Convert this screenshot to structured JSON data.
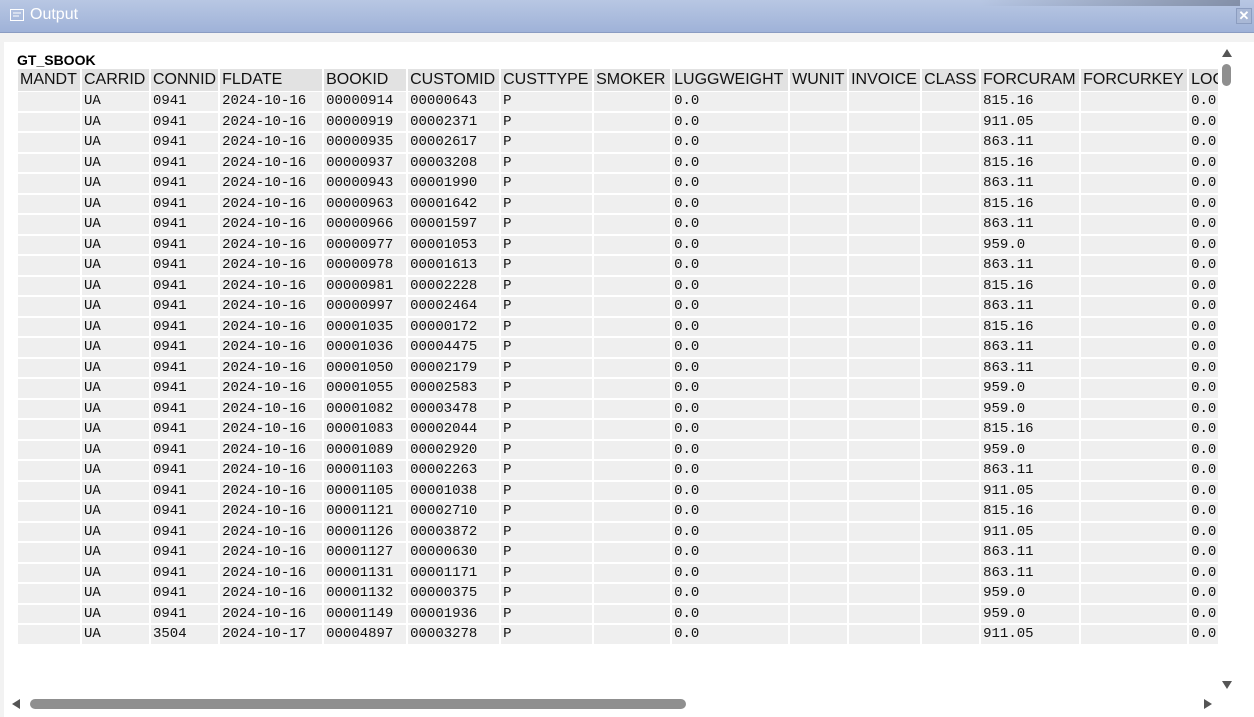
{
  "window": {
    "title": "Output",
    "close_glyph": "✕"
  },
  "table": {
    "title": "GT_SBOOK",
    "columns": [
      "MANDT",
      "CARRID",
      "CONNID",
      "FLDATE",
      "BOOKID",
      "CUSTOMID",
      "CUSTTYPE",
      "SMOKER",
      "LUGGWEIGHT",
      "WUNIT",
      "INVOICE",
      "CLASS",
      "FORCURAM",
      "FORCURKEY",
      "LOCCU"
    ],
    "rows": [
      [
        "",
        "UA",
        "0941",
        "2024-10-16",
        "00000914",
        "00000643",
        "P",
        "",
        "0.0",
        "",
        "",
        "",
        "815.16",
        "",
        "0.0"
      ],
      [
        "",
        "UA",
        "0941",
        "2024-10-16",
        "00000919",
        "00002371",
        "P",
        "",
        "0.0",
        "",
        "",
        "",
        "911.05",
        "",
        "0.0"
      ],
      [
        "",
        "UA",
        "0941",
        "2024-10-16",
        "00000935",
        "00002617",
        "P",
        "",
        "0.0",
        "",
        "",
        "",
        "863.11",
        "",
        "0.0"
      ],
      [
        "",
        "UA",
        "0941",
        "2024-10-16",
        "00000937",
        "00003208",
        "P",
        "",
        "0.0",
        "",
        "",
        "",
        "815.16",
        "",
        "0.0"
      ],
      [
        "",
        "UA",
        "0941",
        "2024-10-16",
        "00000943",
        "00001990",
        "P",
        "",
        "0.0",
        "",
        "",
        "",
        "863.11",
        "",
        "0.0"
      ],
      [
        "",
        "UA",
        "0941",
        "2024-10-16",
        "00000963",
        "00001642",
        "P",
        "",
        "0.0",
        "",
        "",
        "",
        "815.16",
        "",
        "0.0"
      ],
      [
        "",
        "UA",
        "0941",
        "2024-10-16",
        "00000966",
        "00001597",
        "P",
        "",
        "0.0",
        "",
        "",
        "",
        "863.11",
        "",
        "0.0"
      ],
      [
        "",
        "UA",
        "0941",
        "2024-10-16",
        "00000977",
        "00001053",
        "P",
        "",
        "0.0",
        "",
        "",
        "",
        "959.0",
        "",
        "0.0"
      ],
      [
        "",
        "UA",
        "0941",
        "2024-10-16",
        "00000978",
        "00001613",
        "P",
        "",
        "0.0",
        "",
        "",
        "",
        "863.11",
        "",
        "0.0"
      ],
      [
        "",
        "UA",
        "0941",
        "2024-10-16",
        "00000981",
        "00002228",
        "P",
        "",
        "0.0",
        "",
        "",
        "",
        "815.16",
        "",
        "0.0"
      ],
      [
        "",
        "UA",
        "0941",
        "2024-10-16",
        "00000997",
        "00002464",
        "P",
        "",
        "0.0",
        "",
        "",
        "",
        "863.11",
        "",
        "0.0"
      ],
      [
        "",
        "UA",
        "0941",
        "2024-10-16",
        "00001035",
        "00000172",
        "P",
        "",
        "0.0",
        "",
        "",
        "",
        "815.16",
        "",
        "0.0"
      ],
      [
        "",
        "UA",
        "0941",
        "2024-10-16",
        "00001036",
        "00004475",
        "P",
        "",
        "0.0",
        "",
        "",
        "",
        "863.11",
        "",
        "0.0"
      ],
      [
        "",
        "UA",
        "0941",
        "2024-10-16",
        "00001050",
        "00002179",
        "P",
        "",
        "0.0",
        "",
        "",
        "",
        "863.11",
        "",
        "0.0"
      ],
      [
        "",
        "UA",
        "0941",
        "2024-10-16",
        "00001055",
        "00002583",
        "P",
        "",
        "0.0",
        "",
        "",
        "",
        "959.0",
        "",
        "0.0"
      ],
      [
        "",
        "UA",
        "0941",
        "2024-10-16",
        "00001082",
        "00003478",
        "P",
        "",
        "0.0",
        "",
        "",
        "",
        "959.0",
        "",
        "0.0"
      ],
      [
        "",
        "UA",
        "0941",
        "2024-10-16",
        "00001083",
        "00002044",
        "P",
        "",
        "0.0",
        "",
        "",
        "",
        "815.16",
        "",
        "0.0"
      ],
      [
        "",
        "UA",
        "0941",
        "2024-10-16",
        "00001089",
        "00002920",
        "P",
        "",
        "0.0",
        "",
        "",
        "",
        "959.0",
        "",
        "0.0"
      ],
      [
        "",
        "UA",
        "0941",
        "2024-10-16",
        "00001103",
        "00002263",
        "P",
        "",
        "0.0",
        "",
        "",
        "",
        "863.11",
        "",
        "0.0"
      ],
      [
        "",
        "UA",
        "0941",
        "2024-10-16",
        "00001105",
        "00001038",
        "P",
        "",
        "0.0",
        "",
        "",
        "",
        "911.05",
        "",
        "0.0"
      ],
      [
        "",
        "UA",
        "0941",
        "2024-10-16",
        "00001121",
        "00002710",
        "P",
        "",
        "0.0",
        "",
        "",
        "",
        "815.16",
        "",
        "0.0"
      ],
      [
        "",
        "UA",
        "0941",
        "2024-10-16",
        "00001126",
        "00003872",
        "P",
        "",
        "0.0",
        "",
        "",
        "",
        "911.05",
        "",
        "0.0"
      ],
      [
        "",
        "UA",
        "0941",
        "2024-10-16",
        "00001127",
        "00000630",
        "P",
        "",
        "0.0",
        "",
        "",
        "",
        "863.11",
        "",
        "0.0"
      ],
      [
        "",
        "UA",
        "0941",
        "2024-10-16",
        "00001131",
        "00001171",
        "P",
        "",
        "0.0",
        "",
        "",
        "",
        "863.11",
        "",
        "0.0"
      ],
      [
        "",
        "UA",
        "0941",
        "2024-10-16",
        "00001132",
        "00000375",
        "P",
        "",
        "0.0",
        "",
        "",
        "",
        "959.0",
        "",
        "0.0"
      ],
      [
        "",
        "UA",
        "0941",
        "2024-10-16",
        "00001149",
        "00001936",
        "P",
        "",
        "0.0",
        "",
        "",
        "",
        "959.0",
        "",
        "0.0"
      ],
      [
        "",
        "UA",
        "3504",
        "2024-10-17",
        "00004897",
        "00003278",
        "P",
        "",
        "0.0",
        "",
        "",
        "",
        "911.05",
        "",
        "0.0"
      ]
    ]
  },
  "icons": {
    "window": "output-window-icon",
    "close": "close-icon",
    "scroll_up": "scroll-up-arrow-icon",
    "scroll_down": "scroll-down-arrow-icon",
    "scroll_left": "scroll-left-arrow-icon",
    "scroll_right": "scroll-right-arrow-icon"
  },
  "colors": {
    "titlebar": "#a8b9dc",
    "header_cell": "#e2e2e2",
    "row_cell": "#efefef"
  }
}
